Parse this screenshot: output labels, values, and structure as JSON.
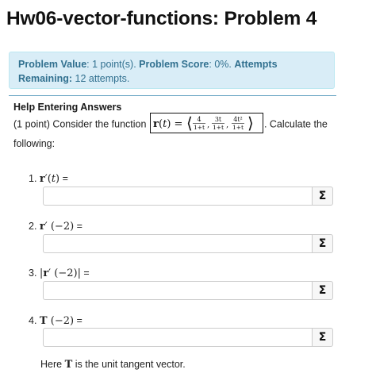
{
  "page": {
    "title": "Hw06-vector-functions: Problem 4"
  },
  "info": {
    "value_label": "Problem Value",
    "value_text": ": 1 point(s). ",
    "score_label": "Problem Score",
    "score_text": ": 0%. ",
    "attempts_label": "Attempts Remaining:",
    "attempts_text": " 12 attempts."
  },
  "help_link": "Help Entering Answers",
  "problem": {
    "lead": "(1 point) Consider the function ",
    "tail": ". Calculate the following:",
    "formula": {
      "lhs": "r(t) =",
      "c1_num": "4",
      "c1_den": "1+t",
      "c2_num": "3t",
      "c2_den": "1+t",
      "c3_num": "4t²",
      "c3_den": "1+t"
    }
  },
  "questions": [
    {
      "number": "1.",
      "math": "r′(t)",
      "suffix": " =",
      "value": ""
    },
    {
      "number": "2.",
      "math": "r′ (−2)",
      "suffix": " =",
      "value": ""
    },
    {
      "number": "3.",
      "math": "|r′ (−2)|",
      "suffix": " =",
      "value": ""
    },
    {
      "number": "4.",
      "math": "T (−2)",
      "suffix": " =",
      "value": ""
    }
  ],
  "sigma_label": "Σ",
  "footnote": {
    "pre": "Here ",
    "math": "T",
    "post": " is the unit tangent vector."
  },
  "colors": {
    "info_bg": "#d9edf7",
    "info_text": "#31708f",
    "divider": "#6aa5c4"
  }
}
